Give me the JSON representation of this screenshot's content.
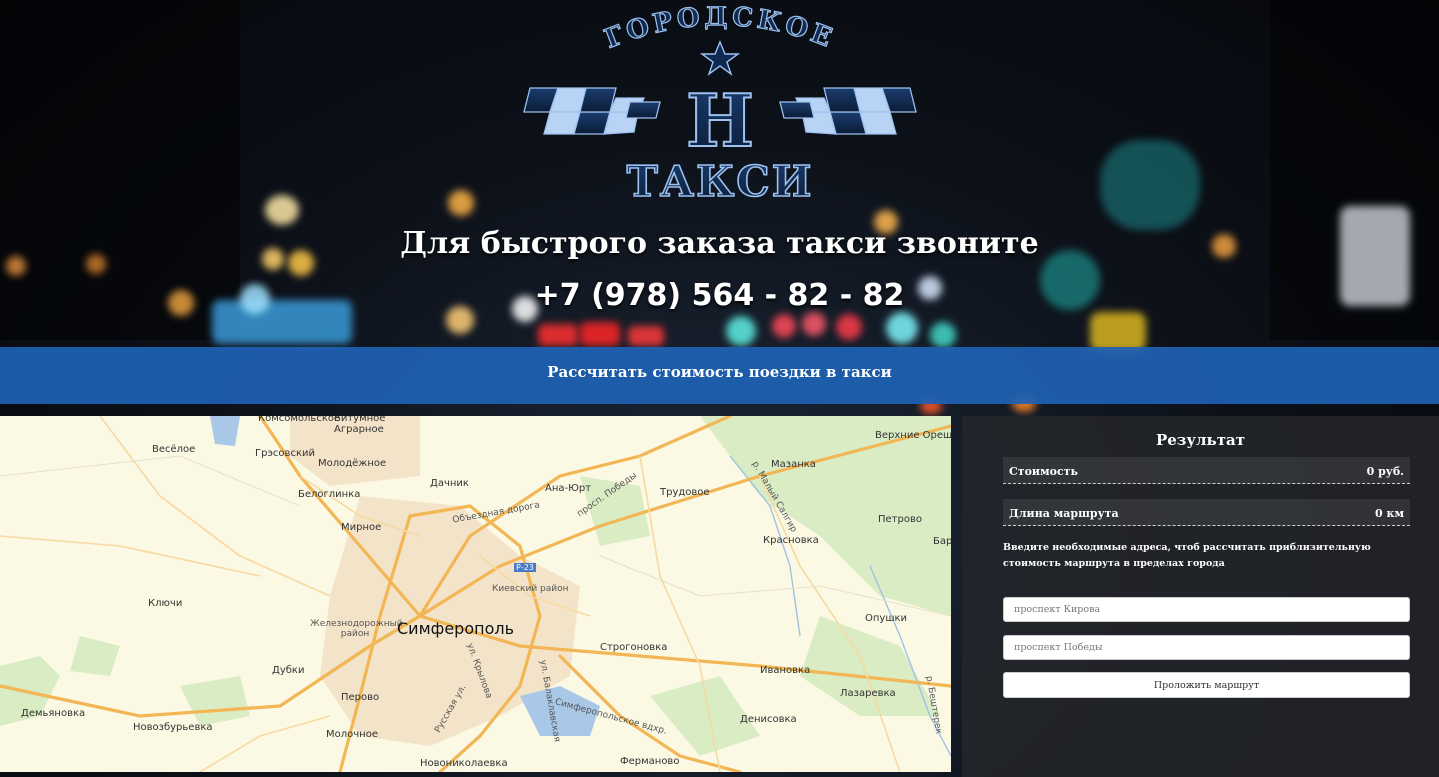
{
  "logo": {
    "top_text": "ГОРОДСКОЕ",
    "bottom_text": "ТАКСИ",
    "monogram": "Н"
  },
  "hero": {
    "headline": "Для быстрого заказа такси звоните",
    "phone": "+7 (978) 564 - 82 - 82"
  },
  "calc_bar": {
    "label": "Рассчитать стоимость поездки в такси"
  },
  "map": {
    "city": "Симферополь",
    "labels": [
      "Комсомольское",
      "Битумное",
      "Аграрное",
      "Весёлое",
      "Грэсовский",
      "Молодёжное",
      "Белоглинка",
      "Дачник",
      "Ана-Юрт",
      "Трудовое",
      "Мазанка",
      "Верхние Орешники",
      "Объездная дорога",
      "просп. Победы",
      "Мирное",
      "Петрово",
      "Красновка",
      "Ключи",
      "Киевский район",
      "Железнодорожный район",
      "Строгоновка",
      "Опушки",
      "Дубки",
      "Ивановка",
      "Перово",
      "Лазаревка",
      "Демьяновка",
      "Новозбурьевка",
      "Денисовка",
      "Молочное",
      "Новониколаевка",
      "Фермановo",
      "Симферопольское вдхр.",
      "р. Малый Салгир",
      "ул. Крылова",
      "Русская ул.",
      "ул. Балаклавская",
      "Р-23",
      "р. Бештерек",
      "Бар"
    ]
  },
  "result": {
    "title": "Результат",
    "cost_label": "Стоимость",
    "cost_value": "0 руб.",
    "length_label": "Длина маршрута",
    "length_value": "0 км",
    "note": "Введите необходимые адреса, чтоб рассчитать приблизительную стоимость маршрута в пределах города",
    "from_placeholder": "проспект Кирова",
    "to_placeholder": "проспект Победы",
    "route_button": "Проложить маршрут"
  },
  "colors": {
    "accent_blue": "#1e62b4",
    "logo_blue": "#8fb4e8"
  }
}
